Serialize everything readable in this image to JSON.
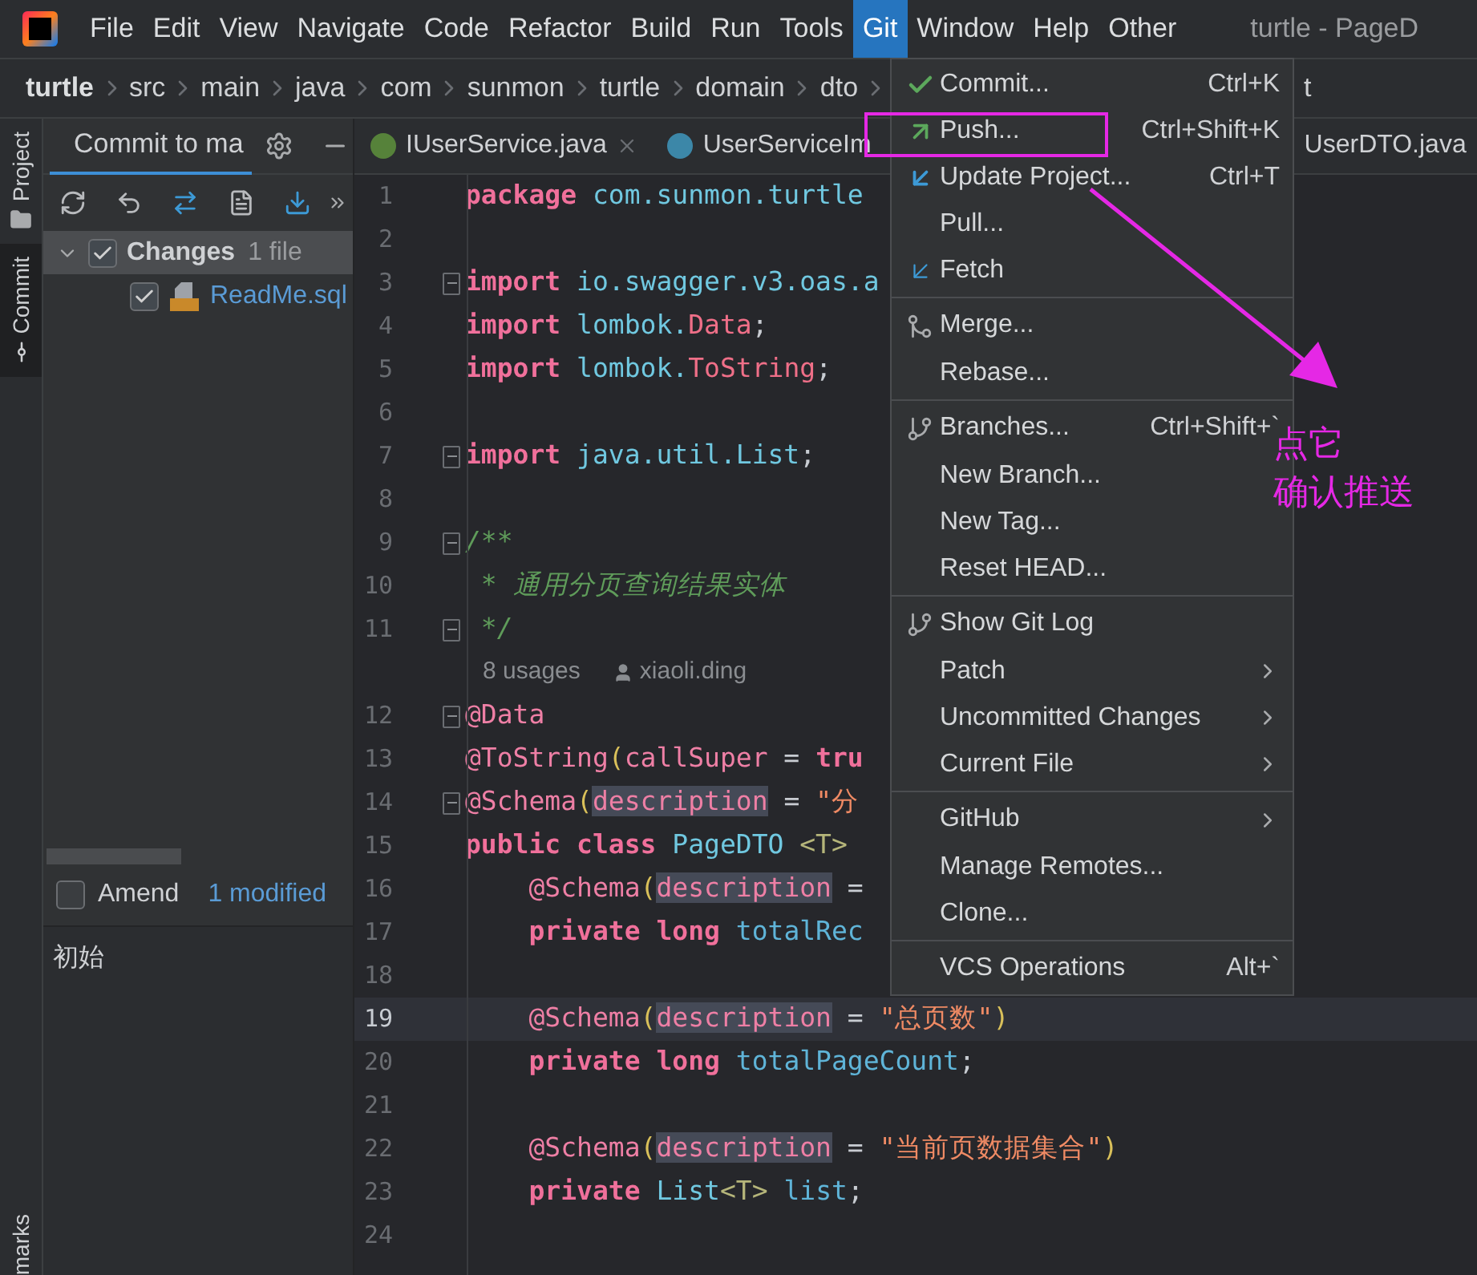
{
  "menu_bar": [
    {
      "label": "File",
      "selected": false
    },
    {
      "label": "Edit",
      "selected": false
    },
    {
      "label": "View",
      "selected": false
    },
    {
      "label": "Navigate",
      "selected": false
    },
    {
      "label": "Code",
      "selected": false
    },
    {
      "label": "Refactor",
      "selected": false
    },
    {
      "label": "Build",
      "selected": false
    },
    {
      "label": "Run",
      "selected": false
    },
    {
      "label": "Tools",
      "selected": false
    },
    {
      "label": "Git",
      "selected": true
    },
    {
      "label": "Window",
      "selected": false
    },
    {
      "label": "Help",
      "selected": false
    },
    {
      "label": "Other",
      "selected": false
    }
  ],
  "window_title": "turtle - PageD",
  "breadcrumbs": [
    "turtle",
    "src",
    "main",
    "java",
    "com",
    "sunmon",
    "turtle",
    "domain",
    "dto"
  ],
  "breadcrumb_tail": "t",
  "tool_strip": [
    {
      "label": "Project",
      "kind": "folder",
      "selected": false
    },
    {
      "label": "Commit",
      "kind": "commit",
      "selected": true
    }
  ],
  "tool_strip_bottom": "marks",
  "commit_panel": {
    "title": "Commit to ma",
    "changes": {
      "label": "Changes",
      "count": "1 file",
      "checked": true,
      "expanded": true,
      "children": [
        {
          "label": "ReadMe.sql",
          "checked": true
        }
      ]
    },
    "amend": {
      "label": "Amend",
      "checked": false
    },
    "modified": "1 modified",
    "message": "初始"
  },
  "editor_tabs": [
    {
      "label": "IUserService.java",
      "kind": "interface",
      "selected": false
    },
    {
      "label": "UserServiceIm",
      "kind": "class",
      "selected": false
    },
    {
      "label": "UserDTO.java",
      "kind": "plain",
      "selected": false
    }
  ],
  "code": [
    {
      "n": "1",
      "fold": false,
      "current": false,
      "tokens": [
        {
          "kind": "kw",
          "text": "package"
        },
        {
          "kind": "pkg",
          "text": " com.sunmon.turtle"
        }
      ]
    },
    {
      "n": "2",
      "fold": false,
      "current": false
    },
    {
      "n": "3",
      "fold": true,
      "current": false,
      "tokens": [
        {
          "kind": "kw",
          "text": "import"
        },
        {
          "kind": "pkg",
          "text": " io.swagger.v3.oas.a"
        }
      ]
    },
    {
      "n": "4",
      "fold": false,
      "current": false,
      "tokens": [
        {
          "kind": "kw",
          "text": "import"
        },
        {
          "kind": "pkg",
          "text": " lombok."
        },
        {
          "kind": "cls",
          "text": "Data"
        },
        {
          "kind": "plain",
          "text": ";"
        }
      ]
    },
    {
      "n": "5",
      "fold": false,
      "current": false,
      "tokens": [
        {
          "kind": "kw",
          "text": "import"
        },
        {
          "kind": "pkg",
          "text": " lombok."
        },
        {
          "kind": "cls",
          "text": "ToString"
        },
        {
          "kind": "plain",
          "text": ";"
        }
      ]
    },
    {
      "n": "6",
      "fold": false,
      "current": false
    },
    {
      "n": "7",
      "fold": true,
      "current": false,
      "tokens": [
        {
          "kind": "kw",
          "text": "import"
        },
        {
          "kind": "pkg",
          "text": " java.util.List"
        },
        {
          "kind": "plain",
          "text": ";"
        }
      ]
    },
    {
      "n": "8",
      "fold": false,
      "current": false
    },
    {
      "n": "9",
      "fold": true,
      "current": false,
      "tokens": [
        {
          "kind": "comment",
          "text": "/**"
        }
      ]
    },
    {
      "n": "10",
      "fold": false,
      "current": false,
      "tokens": [
        {
          "kind": "comment",
          "text": " * 通用分页查询结果实体"
        }
      ]
    },
    {
      "n": "11",
      "fold": true,
      "current": false,
      "tokens": [
        {
          "kind": "comment",
          "text": " */"
        }
      ]
    },
    {
      "kind": "inlay",
      "usages": "8 usages",
      "author": "xiaoli.ding"
    },
    {
      "n": "12",
      "fold": true,
      "current": false,
      "tokens": [
        {
          "kind": "ann",
          "text": "@Data"
        }
      ]
    },
    {
      "n": "13",
      "fold": false,
      "current": false,
      "tokens": [
        {
          "kind": "ann",
          "text": "@ToString"
        },
        {
          "kind": "paren",
          "text": "("
        },
        {
          "kind": "ann",
          "text": "callSuper"
        },
        {
          "kind": "plain",
          "text": " = "
        },
        {
          "kind": "kw",
          "text": "tru"
        }
      ]
    },
    {
      "n": "14",
      "fold": true,
      "current": false,
      "tokens": [
        {
          "kind": "ann",
          "text": "@Schema"
        },
        {
          "kind": "paren",
          "text": "("
        },
        {
          "kind": "param",
          "text": "description"
        },
        {
          "kind": "plain",
          "text": " = "
        },
        {
          "kind": "str",
          "text": "\"分"
        }
      ]
    },
    {
      "n": "15",
      "fold": false,
      "current": false,
      "tokens": [
        {
          "kind": "kw",
          "text": "public class"
        },
        {
          "kind": "pkg",
          "text": " PageDTO "
        },
        {
          "kind": "gen",
          "text": "<T>"
        }
      ]
    },
    {
      "n": "16",
      "fold": false,
      "current": false,
      "tokens": [
        {
          "kind": "ann",
          "text": "    @Schema"
        },
        {
          "kind": "paren",
          "text": "("
        },
        {
          "kind": "param",
          "text": "description"
        },
        {
          "kind": "plain",
          "text": " ="
        }
      ]
    },
    {
      "n": "17",
      "fold": false,
      "current": false,
      "tokens": [
        {
          "kind": "kw",
          "text": "    private long"
        },
        {
          "kind": "field",
          "text": " totalRec"
        }
      ]
    },
    {
      "n": "18",
      "fold": false,
      "current": false
    },
    {
      "n": "19",
      "fold": false,
      "current": true,
      "tokens": [
        {
          "kind": "ann",
          "text": "    @Schema"
        },
        {
          "kind": "paren",
          "text": "("
        },
        {
          "kind": "param",
          "text": "description"
        },
        {
          "kind": "plain",
          "text": " = "
        },
        {
          "kind": "str",
          "text": "\"总页数\""
        },
        {
          "kind": "paren",
          "text": ")"
        }
      ]
    },
    {
      "n": "20",
      "fold": false,
      "current": false,
      "tokens": [
        {
          "kind": "kw",
          "text": "    private long"
        },
        {
          "kind": "field",
          "text": " totalPageCount"
        },
        {
          "kind": "plain",
          "text": ";"
        }
      ]
    },
    {
      "n": "21",
      "fold": false,
      "current": false
    },
    {
      "n": "22",
      "fold": false,
      "current": false,
      "tokens": [
        {
          "kind": "ann",
          "text": "    @Schema"
        },
        {
          "kind": "paren",
          "text": "("
        },
        {
          "kind": "param",
          "text": "description"
        },
        {
          "kind": "plain",
          "text": " = "
        },
        {
          "kind": "str",
          "text": "\"当前页数据集合\""
        },
        {
          "kind": "paren",
          "text": ")"
        }
      ]
    },
    {
      "n": "23",
      "fold": false,
      "current": false,
      "tokens": [
        {
          "kind": "kw",
          "text": "    private"
        },
        {
          "kind": "pkg",
          "text": " List"
        },
        {
          "kind": "gen",
          "text": "<T>"
        },
        {
          "kind": "field",
          "text": " list"
        },
        {
          "kind": "plain",
          "text": ";"
        }
      ]
    },
    {
      "n": "24",
      "fold": false,
      "current": false
    }
  ],
  "git_menu": [
    {
      "label": "Commit...",
      "shortcut": "Ctrl+K",
      "kind": "commit",
      "submenu": false,
      "separator_before": false
    },
    {
      "label": "Push...",
      "shortcut": "Ctrl+Shift+K",
      "kind": "push",
      "submenu": false,
      "separator_before": false
    },
    {
      "label": "Update Project...",
      "shortcut": "Ctrl+T",
      "kind": "update",
      "submenu": false,
      "separator_before": false
    },
    {
      "label": "Pull...",
      "kind": "plain",
      "submenu": false,
      "separator_before": false
    },
    {
      "label": "Fetch",
      "kind": "fetch",
      "submenu": false,
      "separator_before": false
    },
    {
      "label": "Merge...",
      "kind": "merge",
      "submenu": false,
      "separator_before": true
    },
    {
      "label": "Rebase...",
      "kind": "plain",
      "submenu": false,
      "separator_before": false
    },
    {
      "label": "Branches...",
      "shortcut": "Ctrl+Shift+`",
      "kind": "branch",
      "submenu": false,
      "separator_before": true
    },
    {
      "label": "New Branch...",
      "kind": "plain",
      "submenu": false,
      "separator_before": false
    },
    {
      "label": "New Tag...",
      "kind": "plain",
      "submenu": false,
      "separator_before": false
    },
    {
      "label": "Reset HEAD...",
      "kind": "plain",
      "submenu": false,
      "separator_before": false
    },
    {
      "label": "Show Git Log",
      "kind": "branch",
      "submenu": false,
      "separator_before": true
    },
    {
      "label": "Patch",
      "kind": "plain",
      "submenu": true,
      "separator_before": false
    },
    {
      "label": "Uncommitted Changes",
      "kind": "plain",
      "submenu": true,
      "separator_before": false
    },
    {
      "label": "Current File",
      "kind": "plain",
      "submenu": true,
      "separator_before": false
    },
    {
      "label": "GitHub",
      "kind": "plain",
      "submenu": true,
      "separator_before": true
    },
    {
      "label": "Manage Remotes...",
      "kind": "plain",
      "submenu": false,
      "separator_before": false
    },
    {
      "label": "Clone...",
      "kind": "plain",
      "submenu": false,
      "separator_before": false
    },
    {
      "label": "VCS Operations",
      "shortcut": "Alt+`",
      "kind": "plain",
      "submenu": false,
      "separator_before": true
    }
  ],
  "annotation": {
    "lines": [
      "点它",
      "确认推送"
    ]
  }
}
